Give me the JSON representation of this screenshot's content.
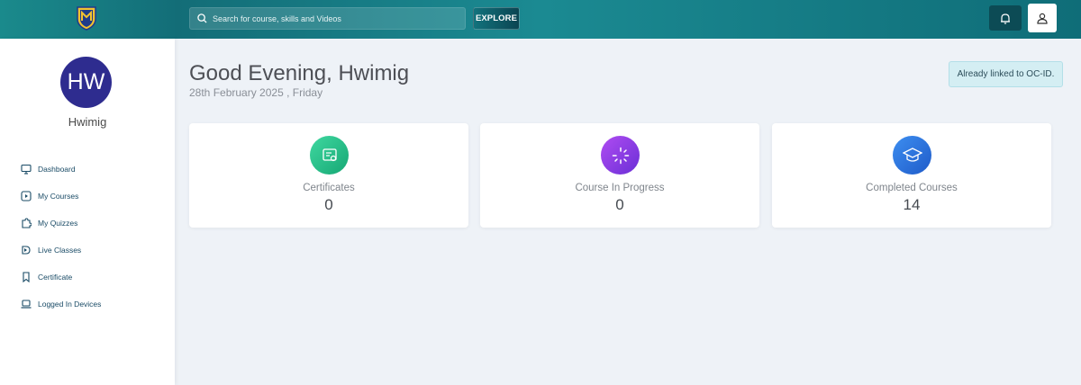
{
  "header": {
    "search": {
      "placeholder": "Search for course, skills and Videos"
    },
    "explore_label": "EXPLORE",
    "icons": {
      "logo": "shield-logo",
      "search": "search-icon",
      "notifications": "bell-icon",
      "profile": "user-icon"
    }
  },
  "sidebar": {
    "avatar_initials": "HW",
    "username": "Hwimig",
    "items": [
      {
        "label": "Dashboard",
        "icon": "monitor-icon"
      },
      {
        "label": "My Courses",
        "icon": "play-icon"
      },
      {
        "label": "My Quizzes",
        "icon": "puzzle-icon"
      },
      {
        "label": "Live Classes",
        "icon": "live-icon"
      },
      {
        "label": "Certificate",
        "icon": "bookmark-icon"
      },
      {
        "label": "Logged In Devices",
        "icon": "laptop-icon"
      }
    ]
  },
  "main": {
    "greeting": "Good Evening, Hwimig",
    "date": "28th February 2025 , Friday",
    "linked_badge": "Already linked to OC-ID.",
    "stats": [
      {
        "label": "Certificates",
        "value": "0",
        "icon": "certificate-icon",
        "color": "#2bc48a"
      },
      {
        "label": "Course In Progress",
        "value": "0",
        "icon": "progress-icon",
        "color": "#8b3fe6"
      },
      {
        "label": "Completed Courses",
        "value": "14",
        "icon": "graduation-cap-icon",
        "color": "#2a6fdc"
      }
    ]
  },
  "colors": {
    "topbar": "#177e87",
    "avatar": "#2e2c8f",
    "nav_text": "#1a4b66",
    "page_bg": "#eef2f7"
  }
}
